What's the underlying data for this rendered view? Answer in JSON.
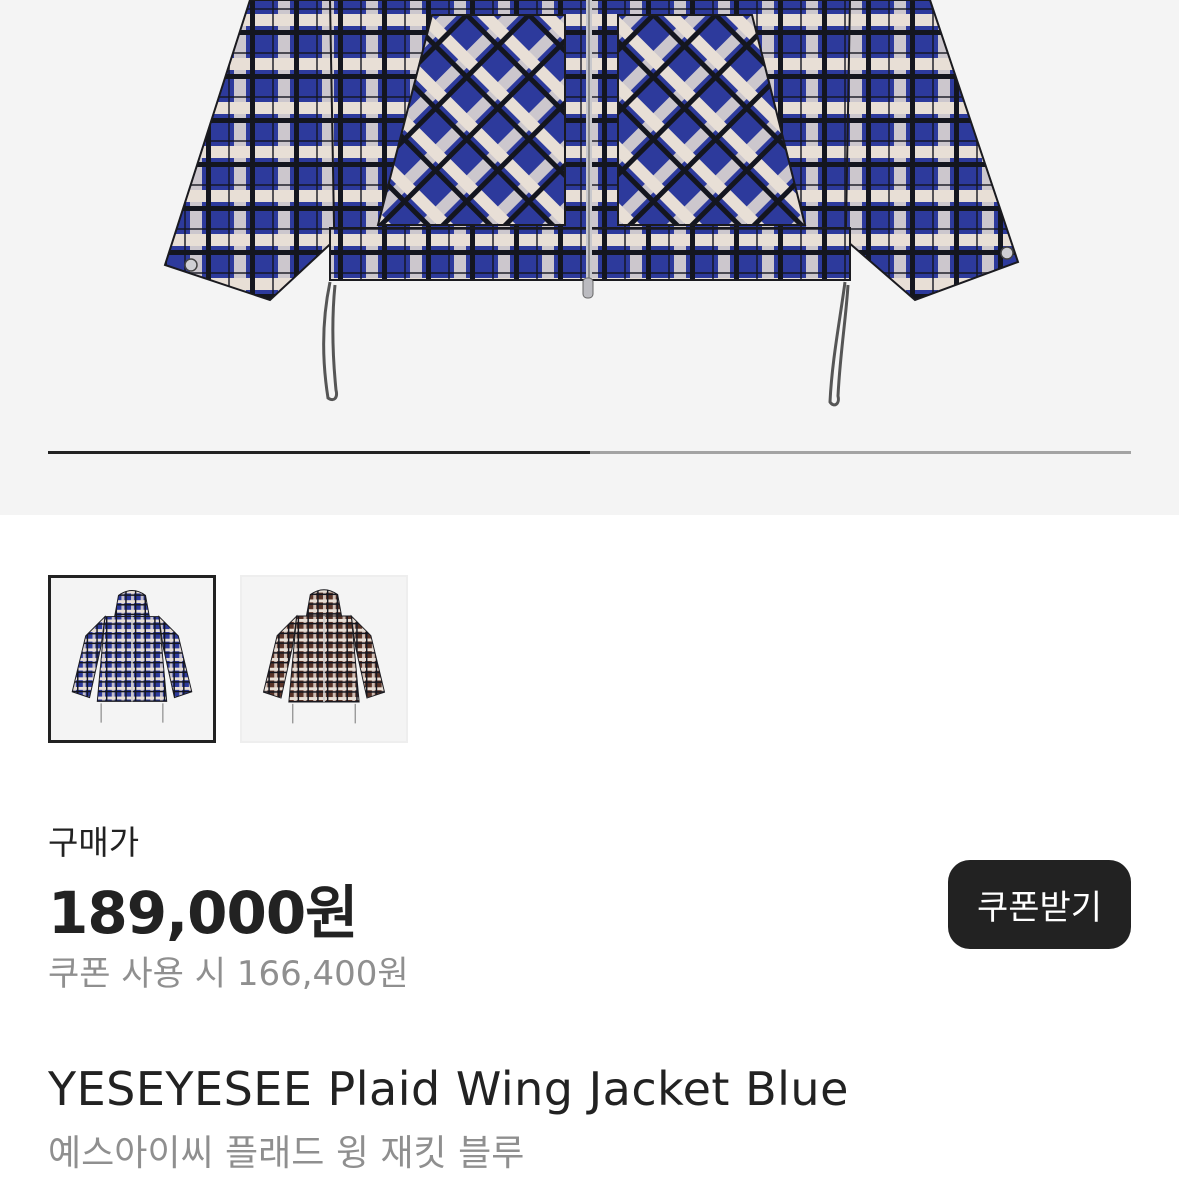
{
  "gallery": {
    "progress": 0.5,
    "thumbnails": [
      {
        "name": "blue-plaid",
        "selected": true,
        "colors": [
          "#2d3a9c",
          "#e8dfd6",
          "#1a1a1f"
        ]
      },
      {
        "name": "brown-plaid",
        "selected": false,
        "colors": [
          "#5a3428",
          "#e8dfd6",
          "#1a1a1f"
        ]
      }
    ]
  },
  "price": {
    "label": "구매가",
    "amount": "189,000원",
    "coupon_price": "쿠폰 사용 시 166,400원"
  },
  "coupon_button": {
    "label": "쿠폰받기"
  },
  "product": {
    "name_en": "YESEYESEE Plaid Wing Jacket Blue",
    "name_ko": "예스아이씨 플래드 윙 재킷 블루"
  },
  "colors": {
    "accent": "#222222",
    "muted_text": "#8f8f8f",
    "hero_bg": "#f4f4f4",
    "plaid_blue": "#2d3a9c",
    "plaid_cream": "#e8dfd6"
  }
}
